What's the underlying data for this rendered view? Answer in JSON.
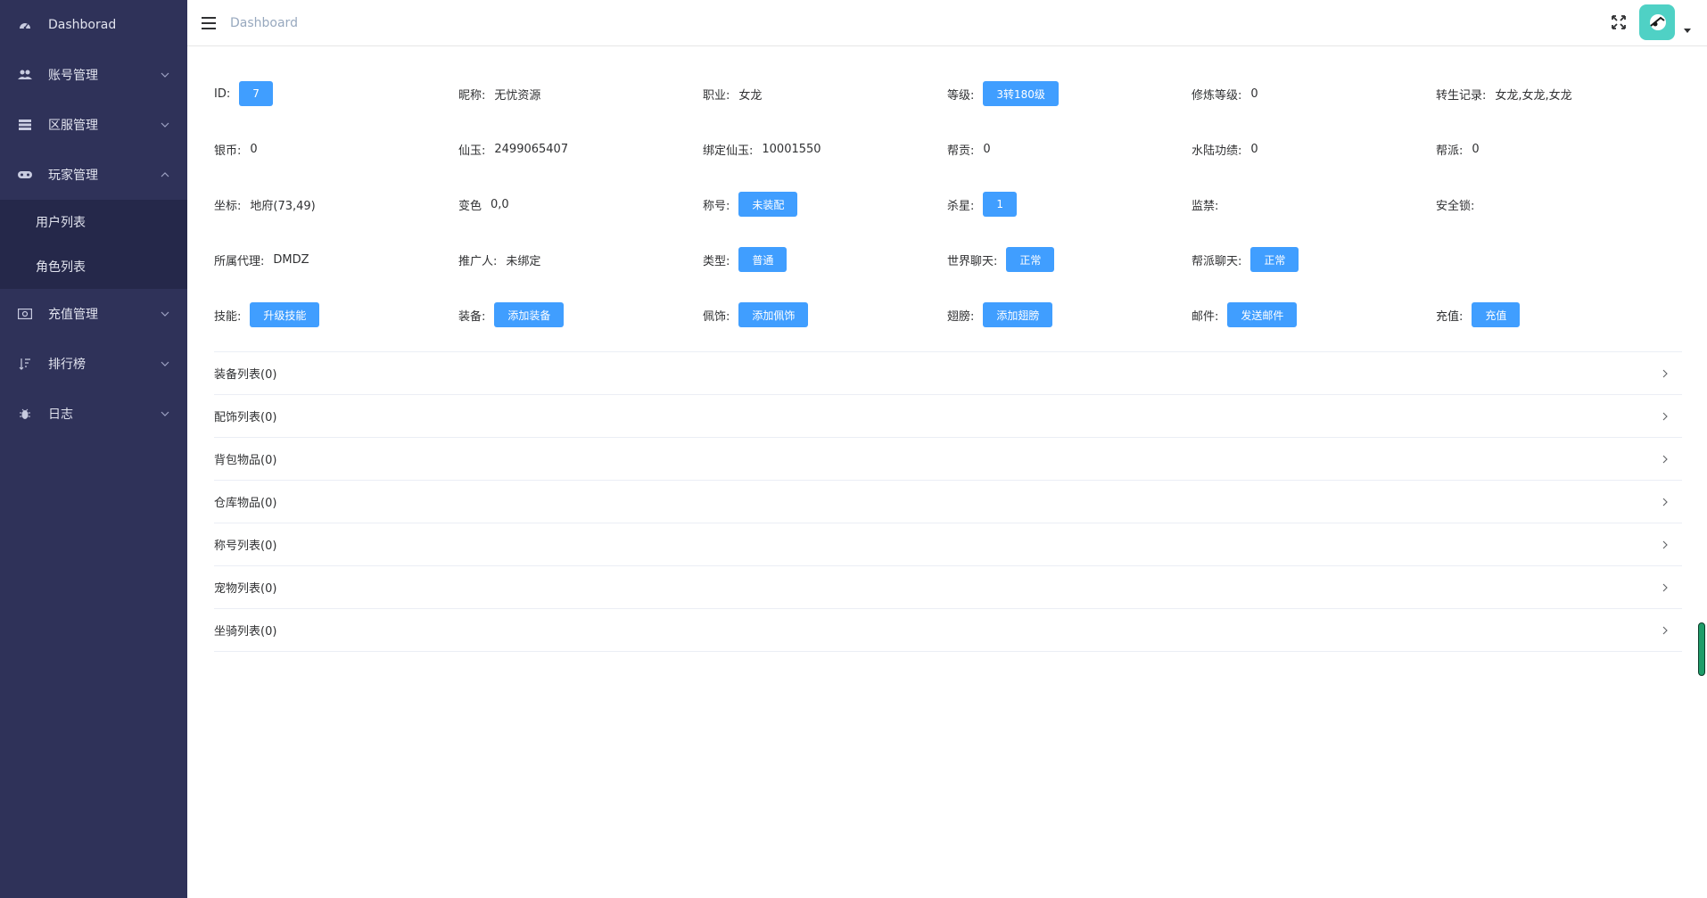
{
  "sidebar": {
    "items": [
      {
        "label": "Dashborad",
        "icon": "dashboard-icon"
      },
      {
        "label": "账号管理",
        "icon": "users-icon"
      },
      {
        "label": "区服管理",
        "icon": "server-icon"
      },
      {
        "label": "玩家管理",
        "icon": "gamepad-icon"
      },
      {
        "label": "充值管理",
        "icon": "money-icon"
      },
      {
        "label": "排行榜",
        "icon": "sort-icon"
      },
      {
        "label": "日志",
        "icon": "bug-icon"
      }
    ],
    "submenu": [
      {
        "label": "用户列表"
      },
      {
        "label": "角色列表"
      }
    ]
  },
  "header": {
    "breadcrumb": "Dashboard"
  },
  "info": {
    "row1": {
      "id_label": "ID:",
      "id_value": "7",
      "nickname_label": "昵称:",
      "nickname_value": "无忧资源",
      "job_label": "职业:",
      "job_value": "女龙",
      "level_label": "等级:",
      "level_value": "3转180级",
      "cultivation_label": "修炼等级:",
      "cultivation_value": "0",
      "rebirth_label": "转生记录:",
      "rebirth_value": "女龙,女龙,女龙"
    },
    "row2": {
      "silver_label": "银币:",
      "silver_value": "0",
      "jade_label": "仙玉:",
      "jade_value": "2499065407",
      "bound_jade_label": "绑定仙玉:",
      "bound_jade_value": "10001550",
      "contribution_label": "帮贡:",
      "contribution_value": "0",
      "land_water_label": "水陆功绩:",
      "land_water_value": "0",
      "guild_label": "帮派:",
      "guild_value": "0"
    },
    "row3": {
      "coord_label": "坐标:",
      "coord_value": "地府(73,49)",
      "color_label": "变色",
      "color_value": "0,0",
      "title_label": "称号:",
      "title_value": "未装配",
      "kill_label": "杀星:",
      "kill_value": "1",
      "ban_label": "监禁:",
      "ban_value": "",
      "lock_label": "安全锁:",
      "lock_value": ""
    },
    "row4": {
      "agent_label": "所属代理:",
      "agent_value": "DMDZ",
      "referrer_label": "推广人:",
      "referrer_value": "未绑定",
      "type_label": "类型:",
      "type_value": "普通",
      "world_chat_label": "世界聊天:",
      "world_chat_value": "正常",
      "guild_chat_label": "帮派聊天:",
      "guild_chat_value": "正常"
    },
    "row5": {
      "skill_label": "技能:",
      "skill_button": "升级技能",
      "equip_label": "装备:",
      "equip_button": "添加装备",
      "accessory_label": "佩饰:",
      "accessory_button": "添加佩饰",
      "wing_label": "翅膀:",
      "wing_button": "添加翅膀",
      "mail_label": "邮件:",
      "mail_button": "发送邮件",
      "recharge_label": "充值:",
      "recharge_button": "充值"
    }
  },
  "collapse": [
    {
      "label": "装备列表(0)"
    },
    {
      "label": "配饰列表(0)"
    },
    {
      "label": "背包物品(0)"
    },
    {
      "label": "仓库物品(0)"
    },
    {
      "label": "称号列表(0)"
    },
    {
      "label": "宠物列表(0)"
    },
    {
      "label": "坐骑列表(0)"
    }
  ],
  "colors": {
    "sidebar_bg": "#2f3259",
    "submenu_bg": "#25284a",
    "primary": "#409eff",
    "avatar_bg": "#4fd1c5"
  }
}
